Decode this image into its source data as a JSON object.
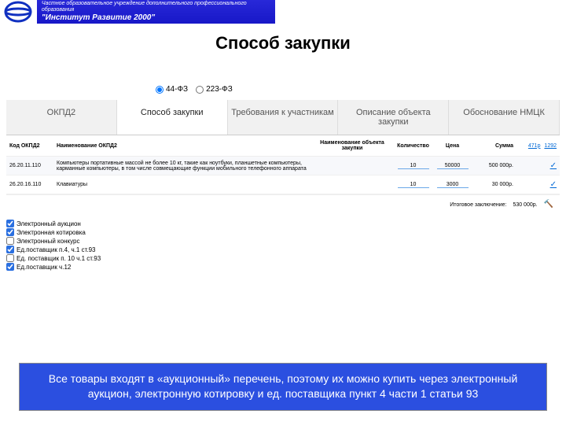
{
  "header": {
    "line1": "Частное образовательное учреждение дополнительного профессионального образования",
    "line2": "\"Институт Развитие 2000\""
  },
  "page_title": "Способ закупки",
  "radios": {
    "r1": "44-ФЗ",
    "r2": "223-ФЗ"
  },
  "tabs": [
    "ОКПД2",
    "Способ закупки",
    "Требования к участникам",
    "Описание объекта закупки",
    "Обоснование НМЦК"
  ],
  "columns": {
    "code": "Код ОКПД2",
    "name": "Наименование ОКПД2",
    "obj": "Наименование объекта закупки",
    "qty": "Количество",
    "price": "Цена",
    "sum": "Сумма",
    "link1": "471р",
    "link2": "1292"
  },
  "rows": [
    {
      "code": "26.20.11.110",
      "name": "Компьютеры портативные массой не более 10 кг, такие как ноутбуки, планшетные компьютеры, карманные компьютеры, в том числе совмещающие функции мобильного телефонного аппарата",
      "qty": "10",
      "price": "50000",
      "sum": "500 000р.",
      "check": true
    },
    {
      "code": "26.20.16.110",
      "name": "Клавиатуры",
      "qty": "10",
      "price": "3000",
      "sum": "30 000р.",
      "check": true
    }
  ],
  "total": {
    "label": "Итоговое заключение:",
    "value": "530 000р."
  },
  "checkboxes": [
    {
      "label": "Электронный аукцион",
      "checked": true
    },
    {
      "label": "Электронная котировка",
      "checked": true
    },
    {
      "label": "Электронный конкурс",
      "checked": false
    },
    {
      "label": "Ед.поставщик п.4, ч.1 ст.93",
      "checked": true
    },
    {
      "label": "Ед. поставщик п. 10 ч.1 ст.93",
      "checked": false
    },
    {
      "label": "Ед.поставщик ч.12",
      "checked": true
    }
  ],
  "footer": "Все товары входят в «аукционный» перечень, поэтому их можно купить через электронный аукцион, электронную котировку и ед. поставщика пункт 4 части 1 статьи 93"
}
